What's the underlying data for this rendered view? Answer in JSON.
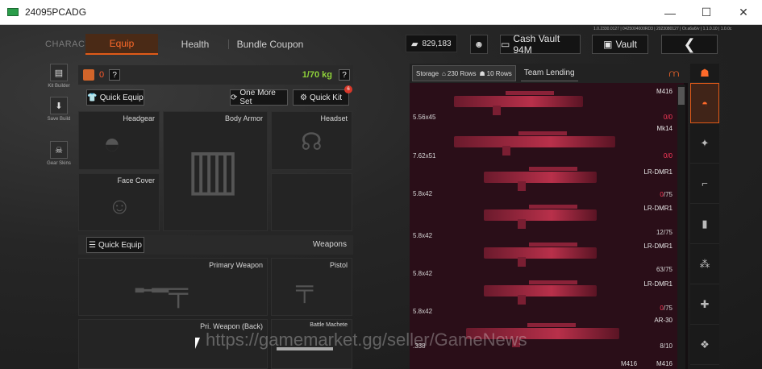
{
  "window": {
    "title": "24095PCADG"
  },
  "nav": {
    "character": "CHARACTER",
    "equip": "Equip",
    "health": "Health",
    "bundle": "Bundle Coupon"
  },
  "topbar": {
    "money": "829,183",
    "cash_vault": "Cash Vault 94M",
    "vault": "Vault",
    "version": "1.0.2330.0127 | 0425004000RD3 | 2023080127 | Or.a6a6/v | 1.1.0.10 | 1.0.0c"
  },
  "sidebar": [
    {
      "label": "Kit Builder",
      "icon": "kit-builder-icon"
    },
    {
      "label": "Save Build",
      "icon": "save-build-icon"
    },
    {
      "label": "Gear Skins",
      "icon": "gear-skins-icon"
    }
  ],
  "equip": {
    "weight_zero": "0",
    "help": "?",
    "weight": "1/70 kg",
    "quick_equip": "Quick Equip",
    "one_more_set": "One More Set",
    "quick_kit": "Quick Kit",
    "quick_kit_badge": "6",
    "slots": {
      "headgear": "Headgear",
      "body_armor": "Body Armor",
      "headset": "Headset",
      "face_cover": "Face Cover"
    },
    "weapons_title": "Weapons",
    "weapons_quick_equip": "Quick Equip",
    "weapon_slots": {
      "primary": "Primary Weapon",
      "pistol": "Pistol",
      "pri_back": "Pri. Weapon (Back)",
      "melee": "Battle Machete"
    }
  },
  "storage": {
    "tab": "Storage",
    "rows_info": "230 Rows",
    "rows_info2": "10 Rows",
    "team_lending": "Team Lending",
    "items": [
      {
        "name": "M416",
        "caliber": "5.56x45",
        "ammo_a": "0",
        "ammo_b": "/0"
      },
      {
        "name": "Mk14",
        "caliber": "7.62x51",
        "ammo_a": "0",
        "ammo_b": "/0"
      },
      {
        "name": "LR-DMR1",
        "caliber": "5.8x42",
        "ammo_a": "0",
        "ammo_b": "/75"
      },
      {
        "name": "LR-DMR1",
        "caliber": "5.8x42",
        "ammo_a": "12",
        "ammo_b": "/75"
      },
      {
        "name": "LR-DMR1",
        "caliber": "5.8x42",
        "ammo_a": "63",
        "ammo_b": "/75"
      },
      {
        "name": "LR-DMR1",
        "caliber": "5.8x42",
        "ammo_a": "0",
        "ammo_b": "/75"
      },
      {
        "name": "AR-30",
        "caliber": ".338",
        "ammo_a": "8",
        "ammo_b": "/10"
      }
    ],
    "bottom_a": "M416",
    "bottom_b": "M416"
  },
  "watermark": "https://gamemarket.gg/seller/GameNews"
}
